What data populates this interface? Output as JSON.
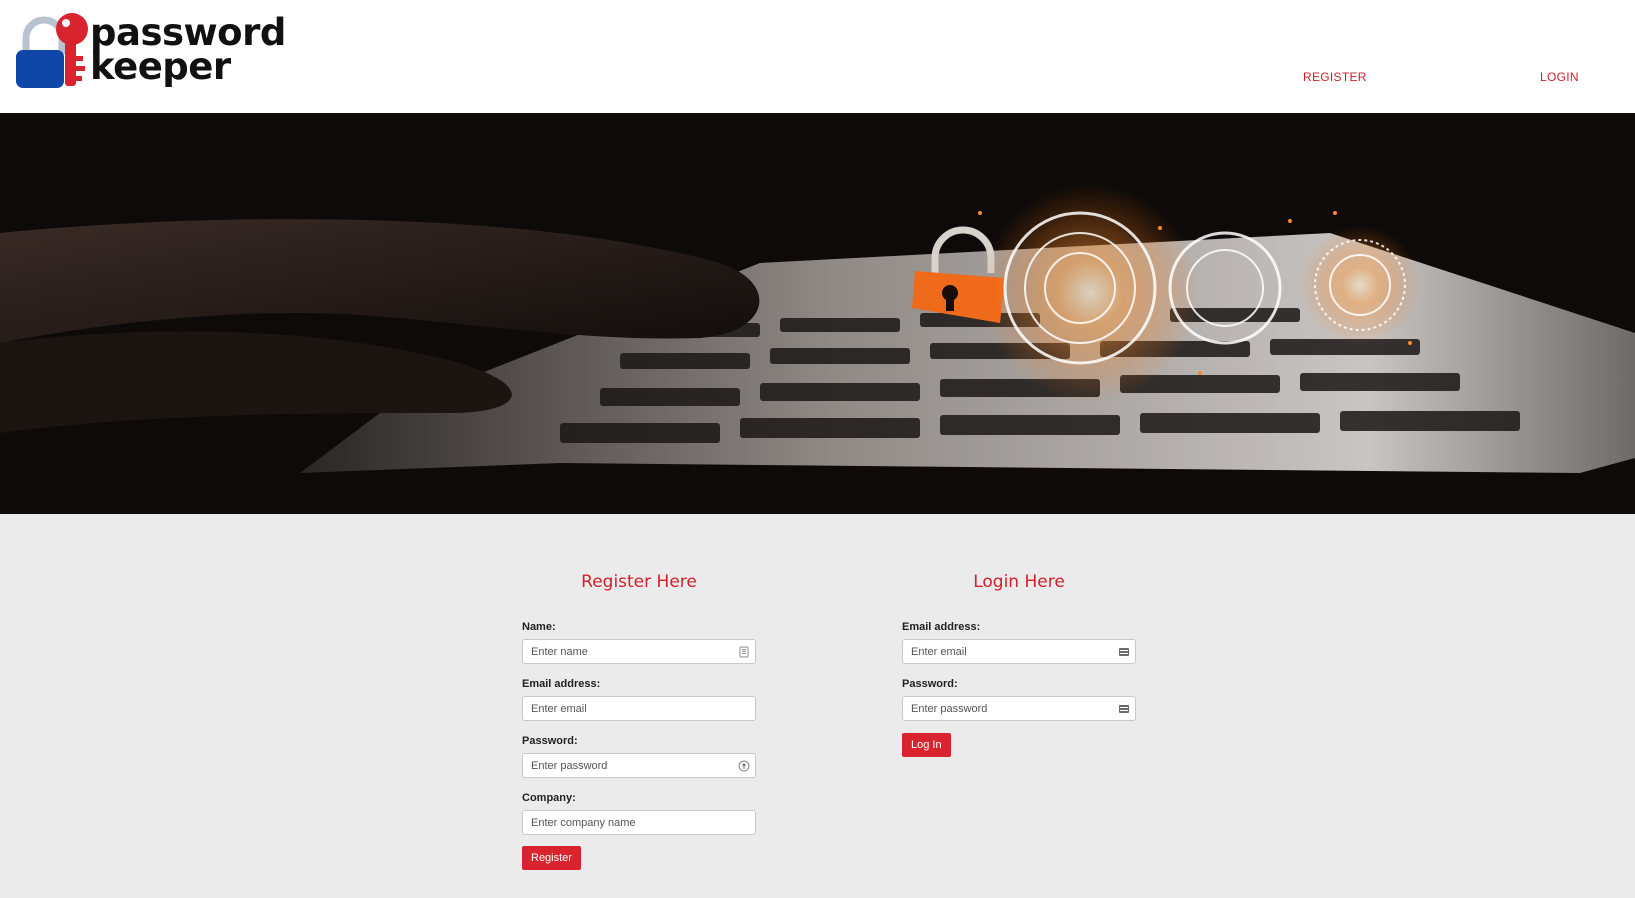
{
  "brand": {
    "line1": "password",
    "line2": "keeper",
    "colors": {
      "lock_blue": "#0e47a8",
      "key_red": "#d9232f",
      "text": "#111111"
    }
  },
  "nav": {
    "register": "REGISTER",
    "login": "LOGIN",
    "link_color": "#d0202a"
  },
  "hero": {
    "image": "hands-typing-laptop-with-padlock-hologram"
  },
  "register_form": {
    "title": "Register Here",
    "name_label": "Name:",
    "name_placeholder": "Enter name",
    "email_label": "Email address:",
    "email_placeholder": "Enter email",
    "password_label": "Password:",
    "password_placeholder": "Enter password",
    "company_label": "Company:",
    "company_placeholder": "Enter company name",
    "submit_label": "Register"
  },
  "login_form": {
    "title": "Login Here",
    "email_label": "Email address:",
    "email_placeholder": "Enter email",
    "password_label": "Password:",
    "password_placeholder": "Enter password",
    "submit_label": "Log In"
  },
  "accent": "#d9232f"
}
